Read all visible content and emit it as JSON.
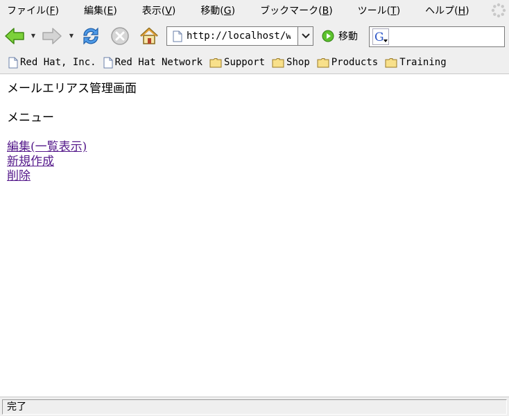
{
  "menu": {
    "items": [
      {
        "label": "ファイル(",
        "key": "F",
        "suffix": ")"
      },
      {
        "label": "編集(",
        "key": "E",
        "suffix": ")"
      },
      {
        "label": "表示(",
        "key": "V",
        "suffix": ")"
      },
      {
        "label": "移動(",
        "key": "G",
        "suffix": ")"
      },
      {
        "label": "ブックマーク(",
        "key": "B",
        "suffix": ")"
      },
      {
        "label": "ツール(",
        "key": "T",
        "suffix": ")"
      },
      {
        "label": "ヘルプ(",
        "key": "H",
        "suffix": ")"
      }
    ]
  },
  "toolbar": {
    "url": "http://localhost/w",
    "go_label": "移動"
  },
  "bookmarks": [
    {
      "label": "Red Hat, Inc.",
      "icon": "page-icon"
    },
    {
      "label": "Red Hat Network",
      "icon": "page-icon"
    },
    {
      "label": "Support",
      "icon": "folder-icon"
    },
    {
      "label": "Shop",
      "icon": "folder-icon"
    },
    {
      "label": "Products",
      "icon": "folder-icon"
    },
    {
      "label": "Training",
      "icon": "folder-icon"
    }
  ],
  "page": {
    "title": "メールエリアス管理画面",
    "menu_heading": "メニュー",
    "links": [
      {
        "label": "編集(一覧表示)"
      },
      {
        "label": "新規作成"
      },
      {
        "label": "削除"
      }
    ]
  },
  "status": {
    "text": "完了"
  },
  "colors": {
    "link_visited": "#551a8b",
    "chrome_bg": "#efefef"
  }
}
